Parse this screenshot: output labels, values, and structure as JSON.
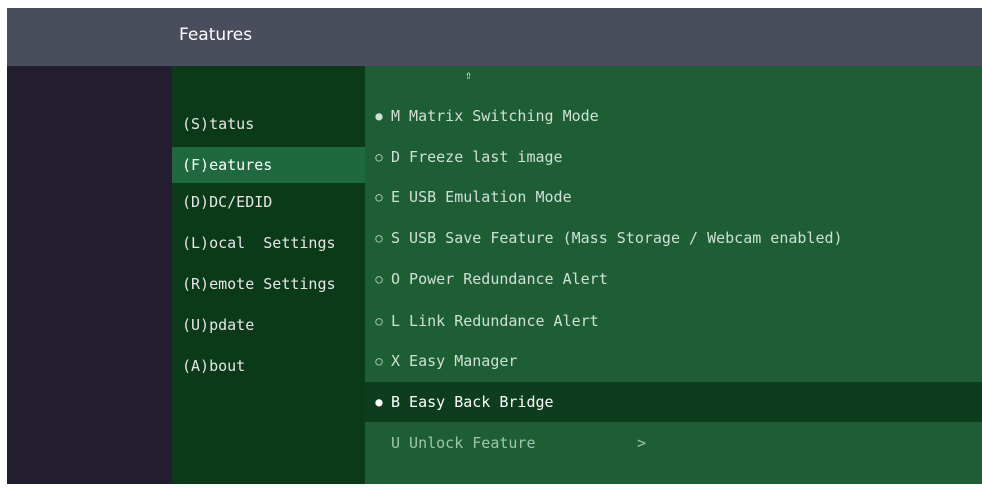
{
  "header": {
    "title": "Features"
  },
  "menu": {
    "items": [
      {
        "label": "(S)tatus",
        "active": false
      },
      {
        "label": "(F)eatures",
        "active": true
      },
      {
        "label": "(D)DC/EDID",
        "active": false
      },
      {
        "label": "(L)ocal  Settings",
        "active": false
      },
      {
        "label": "(R)emote Settings",
        "active": false
      },
      {
        "label": "(U)pdate",
        "active": false
      },
      {
        "label": "(A)bout",
        "active": false
      }
    ]
  },
  "features": {
    "scroll_up_icon": "up-arrow-icon",
    "scroll_up_glyph": "⇧",
    "items": [
      {
        "bullet": "●",
        "enabled": true,
        "label": "M Matrix Switching Mode"
      },
      {
        "bullet": "○",
        "enabled": false,
        "label": "D Freeze last image"
      },
      {
        "bullet": "○",
        "enabled": false,
        "label": "E USB Emulation Mode"
      },
      {
        "bullet": "○",
        "enabled": false,
        "label": "S USB Save Feature (Mass Storage / Webcam enabled)"
      },
      {
        "bullet": "○",
        "enabled": false,
        "label": "O Power Redundance Alert"
      },
      {
        "bullet": "○",
        "enabled": false,
        "label": "L Link Redundance Alert"
      },
      {
        "bullet": "○",
        "enabled": false,
        "label": "X Easy Manager"
      },
      {
        "bullet": "●",
        "enabled": true,
        "label": "B Easy Back Bridge"
      }
    ],
    "unlock": {
      "label": "U Unlock Feature",
      "chevron": ">"
    }
  },
  "colors": {
    "titlebar": "#4a4e5c",
    "menu_bg": "#0a3a18",
    "menu_active": "#1e6a3e",
    "content_bg": "#1d5e35",
    "selected_row": "#0d3d1c"
  }
}
